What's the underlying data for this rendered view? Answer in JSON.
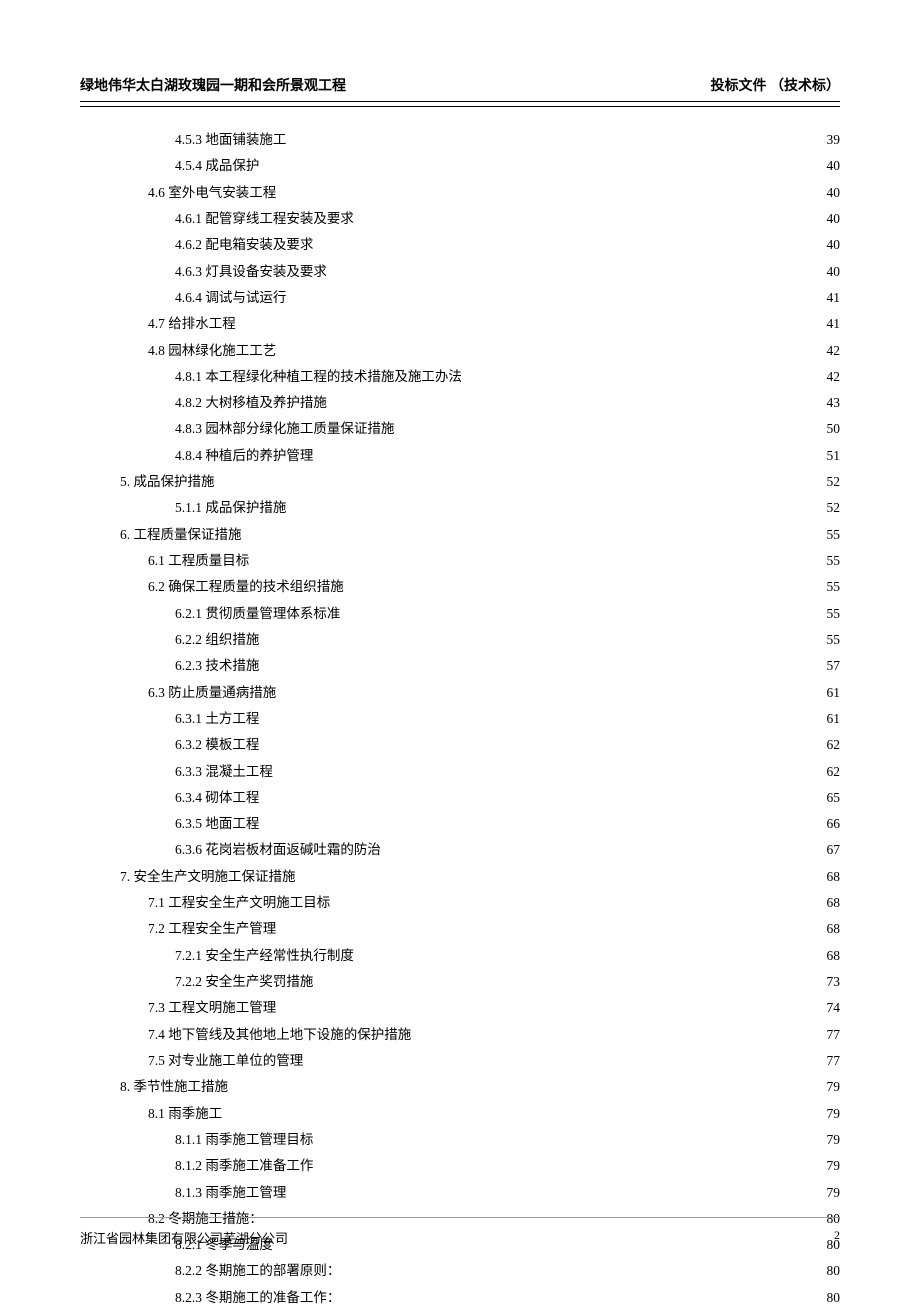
{
  "header": {
    "left": "绿地伟华太白湖玫瑰园一期和会所景观工程",
    "right": "投标文件 （技术标）"
  },
  "footer": {
    "company": "浙江省园林集团有限公司芜湖分公司",
    "pagenum": "2"
  },
  "toc": [
    {
      "indent": 4,
      "label": "4.5.3 地面铺装施工",
      "page": "39"
    },
    {
      "indent": 4,
      "label": "4.5.4 成品保护",
      "page": "40"
    },
    {
      "indent": 3,
      "label": "4.6 室外电气安装工程",
      "page": "40"
    },
    {
      "indent": 4,
      "label": "4.6.1 配管穿线工程安装及要求",
      "page": "40"
    },
    {
      "indent": 4,
      "label": "4.6.2 配电箱安装及要求",
      "page": "40"
    },
    {
      "indent": 4,
      "label": "4.6.3 灯具设备安装及要求",
      "page": "40"
    },
    {
      "indent": 4,
      "label": "4.6.4 调试与试运行",
      "page": "41"
    },
    {
      "indent": 3,
      "label": "4.7 给排水工程",
      "page": "41"
    },
    {
      "indent": 3,
      "label": "4.8 园林绿化施工工艺",
      "page": "42"
    },
    {
      "indent": 4,
      "label": "4.8.1 本工程绿化种植工程的技术措施及施工办法",
      "page": "42"
    },
    {
      "indent": 4,
      "label": "4.8.2 大树移植及养护措施",
      "page": "43"
    },
    {
      "indent": 4,
      "label": "4.8.3 园林部分绿化施工质量保证措施",
      "page": "50"
    },
    {
      "indent": 4,
      "label": "4.8.4 种植后的养护管理",
      "page": "51"
    },
    {
      "indent": 2,
      "label": "5. 成品保护措施",
      "page": "52"
    },
    {
      "indent": 4,
      "label": "5.1.1 成品保护措施",
      "page": "52"
    },
    {
      "indent": 2,
      "label": "6. 工程质量保证措施",
      "page": "55"
    },
    {
      "indent": 3,
      "label": "6.1 工程质量目标",
      "page": "55"
    },
    {
      "indent": 3,
      "label": "6.2 确保工程质量的技术组织措施",
      "page": "55"
    },
    {
      "indent": 4,
      "label": "6.2.1 贯彻质量管理体系标准",
      "page": "55"
    },
    {
      "indent": 4,
      "label": "6.2.2 组织措施",
      "page": "55"
    },
    {
      "indent": 4,
      "label": "6.2.3 技术措施",
      "page": "57"
    },
    {
      "indent": 3,
      "label": "6.3 防止质量通病措施",
      "page": "61"
    },
    {
      "indent": 4,
      "label": "6.3.1 土方工程",
      "page": "61"
    },
    {
      "indent": 4,
      "label": "6.3.2 模板工程",
      "page": "62"
    },
    {
      "indent": 4,
      "label": "6.3.3 混凝土工程",
      "page": "62"
    },
    {
      "indent": 4,
      "label": "6.3.4 砌体工程",
      "page": "65"
    },
    {
      "indent": 4,
      "label": "6.3.5 地面工程",
      "page": "66"
    },
    {
      "indent": 4,
      "label": "6.3.6 花岗岩板材面返碱吐霜的防治",
      "page": "67"
    },
    {
      "indent": 2,
      "label": "7. 安全生产文明施工保证措施",
      "page": "68"
    },
    {
      "indent": 3,
      "label": "7.1 工程安全生产文明施工目标",
      "page": "68"
    },
    {
      "indent": 3,
      "label": "7.2 工程安全生产管理",
      "page": "68"
    },
    {
      "indent": 4,
      "label": "7.2.1 安全生产经常性执行制度",
      "page": "68"
    },
    {
      "indent": 4,
      "label": "7.2.2 安全生产奖罚措施",
      "page": "73"
    },
    {
      "indent": 3,
      "label": "7.3 工程文明施工管理",
      "page": "74"
    },
    {
      "indent": 3,
      "label": "7.4 地下管线及其他地上地下设施的保护措施",
      "page": "77"
    },
    {
      "indent": 3,
      "label": "7.5 对专业施工单位的管理",
      "page": "77"
    },
    {
      "indent": 2,
      "label": "8. 季节性施工措施",
      "page": "79"
    },
    {
      "indent": 3,
      "label": "8.1 雨季施工",
      "page": "79"
    },
    {
      "indent": 4,
      "label": "8.1.1 雨季施工管理目标",
      "page": "79"
    },
    {
      "indent": 4,
      "label": "8.1.2 雨季施工准备工作",
      "page": "79"
    },
    {
      "indent": 4,
      "label": "8.1.3 雨季施工管理",
      "page": "79"
    },
    {
      "indent": 3,
      "label": "8.2 冬期施工措施：",
      "page": "80"
    },
    {
      "indent": 4,
      "label": "8.2.1 冬季与温度",
      "page": "80"
    },
    {
      "indent": 4,
      "label": "8.2.2 冬期施工的部署原则：",
      "page": "80"
    },
    {
      "indent": 4,
      "label": "8.2.3 冬期施工的准备工作：",
      "page": "80"
    }
  ]
}
